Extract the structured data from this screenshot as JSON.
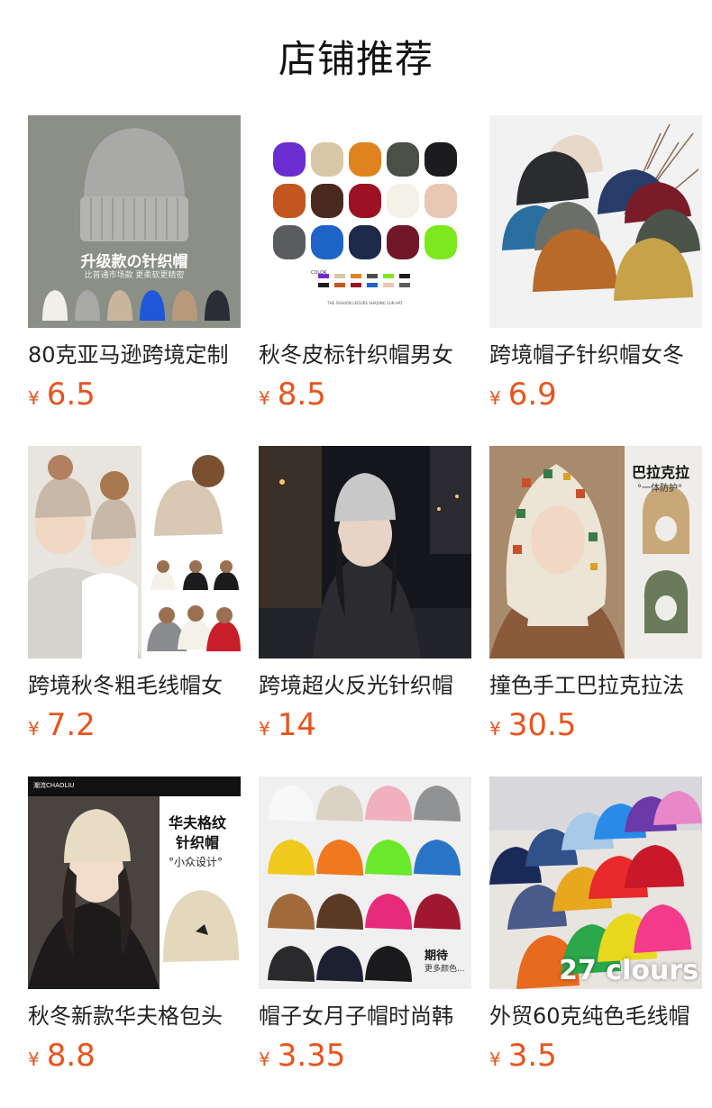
{
  "page": {
    "title": "店铺推荐",
    "currency_symbol": "¥",
    "accent_color": "#e8541e"
  },
  "products": [
    {
      "title": "80克亚马逊跨境定制",
      "price": "6.5",
      "thumb": {
        "headline": "升级款の针织帽",
        "subline": "比普通市场款 更柔软更精密"
      }
    },
    {
      "title": "秋冬皮标针织帽男女",
      "price": "8.5",
      "thumb": {
        "color_label": "COLOR",
        "footer": "THE FASHION LEISURE SHADING SUN HAT"
      }
    },
    {
      "title": "跨境帽子针织帽女冬",
      "price": "6.9",
      "thumb": {}
    },
    {
      "title": "跨境秋冬粗毛线帽女",
      "price": "7.2",
      "thumb": {}
    },
    {
      "title": "跨境超火反光针织帽",
      "price": "14",
      "thumb": {}
    },
    {
      "title": "撞色手工巴拉克拉法",
      "price": "30.5",
      "thumb": {
        "headline": "巴拉克拉",
        "subline": "°一体防护°"
      }
    },
    {
      "title": "秋冬新款华夫格包头",
      "price": "8.8",
      "thumb": {
        "brand": "潮流CHAOLIU",
        "headline_1": "华夫格纹",
        "headline_2": "针织帽",
        "subline": "°小众设计°"
      }
    },
    {
      "title": "帽子女月子帽时尚韩",
      "price": "3.35",
      "thumb": {
        "headline": "期待",
        "subline": "更多颜色..."
      }
    },
    {
      "title": "外贸60克纯色毛线帽",
      "price": "3.5",
      "thumb": {
        "overlay": "27 clours"
      }
    }
  ]
}
